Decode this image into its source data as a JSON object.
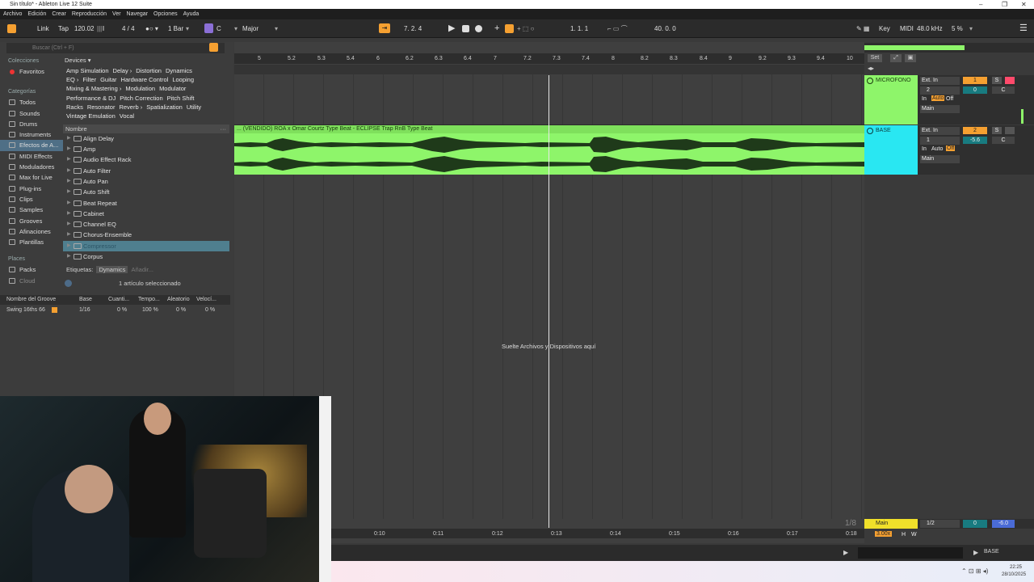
{
  "window": {
    "title": "Sin título* - Ableton Live 12 Suite"
  },
  "menu": [
    "Archivo",
    "Edición",
    "Crear",
    "Reproducción",
    "Ver",
    "Navegar",
    "Opciones",
    "Ayuda"
  ],
  "control": {
    "link": "Link",
    "tap": "Tap",
    "tempo": "120.02",
    "meter": "4 / 4",
    "quant": "1 Bar",
    "key_root": "C",
    "scale": "Major",
    "position": "7.   2.   4",
    "loop_start": "1.   1.   1",
    "loop_len": "40.   0.   0",
    "key": "Key",
    "midi": "MIDI",
    "sample_rate": "48.0 kHz",
    "cpu": "5 %"
  },
  "browser": {
    "search_placeholder": "Buscar (Ctrl + F)",
    "collections_header": "Colecciones",
    "favorites": "Favoritos",
    "categories_header": "Categorías",
    "categories": [
      "Todos",
      "Sounds",
      "Drums",
      "Instruments",
      "Efectos de A...",
      "MIDI Effects",
      "Moduladores",
      "Max for Live",
      "Plug-ins",
      "Clips",
      "Samples",
      "Grooves",
      "Afinaciones",
      "Plantillas"
    ],
    "places_header": "Places",
    "places": [
      "Packs",
      "Cloud"
    ],
    "devices_label": "Devices ▾",
    "tag_rows": [
      [
        "Amp Simulation",
        "Delay ›",
        "Distortion",
        "Dynamics"
      ],
      [
        "EQ ›",
        "Filter",
        "Guitar",
        "Hardware Control",
        "Looping"
      ],
      [
        "Mixing & Mastering ›",
        "Modulation",
        "Modulator"
      ],
      [
        "Performance & DJ",
        "Pitch Correction",
        "Pitch Shift"
      ],
      [
        "Racks",
        "Resonator",
        "Reverb ›",
        "Spatialization",
        "Utility"
      ],
      [
        "Vintage Emulation",
        "Vocal"
      ]
    ],
    "name_header": "Nombre",
    "files": [
      "Align Delay",
      "Amp",
      "Audio Effect Rack",
      "Auto Filter",
      "Auto Pan",
      "Auto Shift",
      "Beat Repeat",
      "Cabinet",
      "Channel EQ",
      "Chorus-Ensemble",
      "Compressor",
      "Corpus"
    ],
    "tags_label": "Etiquetas:",
    "tag_value": "Dynamics",
    "tag_add": "Añadir...",
    "status": "1 artículo seleccionado"
  },
  "groove": {
    "headers": [
      "Nombre del Groove",
      "Base",
      "Cuanti...",
      "Tempo...",
      "Aleatorio",
      "Velocí..."
    ],
    "row": [
      "Swing 16ths 66",
      "1/16",
      "0 %",
      "100 %",
      "0 %",
      "0 %"
    ]
  },
  "ruler": [
    "5",
    "5.2",
    "5.3",
    "5.4",
    "6",
    "6.2",
    "6.3",
    "6.4",
    "7",
    "7.2",
    "7.3",
    "7.4",
    "8",
    "8.2",
    "8.3",
    "8.4",
    "9",
    "9.2",
    "9.3",
    "9.4",
    "10"
  ],
  "time_ruler": [
    "0:10",
    "0:11",
    "0:12",
    "0:13",
    "0:14",
    "0:15",
    "0:16",
    "0:17",
    "0:18"
  ],
  "set_label": "Set",
  "clip_name": "... (VENDIDO) ROA x Omar Courtz Type Beat - ECLIPSE Trap RnB Type Beat",
  "drop_text": "Suelte Archivos y Dispositivos aquí",
  "tracks": [
    {
      "name": "MICROFONO",
      "input": "Ext. In",
      "channel": "2",
      "in": "In",
      "auto": "Auto",
      "off": "Off",
      "out": "Main",
      "num": "1",
      "send": "0",
      "pan": "C",
      "color": "#8ef56a"
    },
    {
      "name": "BASE",
      "input": "Ext. In",
      "channel": "1",
      "in": "In",
      "auto": "Auto",
      "off": "Off",
      "out": "Main",
      "num": "2",
      "send": "-5.6",
      "pan": "C",
      "color": "#29e7f2"
    }
  ],
  "master": {
    "name": "Main",
    "quant": "1/2",
    "send": "0",
    "vol": "-6.0",
    "zoom": "3.00x",
    "h": "H",
    "w": "W",
    "frac": "1/8"
  },
  "status_track": "BASE",
  "taskbar": {
    "time": "22:25",
    "date": "28/10/2025"
  },
  "colors": {
    "accent": "#f5a031",
    "clip": "#8ef56a",
    "cyan": "#29e7f2"
  }
}
